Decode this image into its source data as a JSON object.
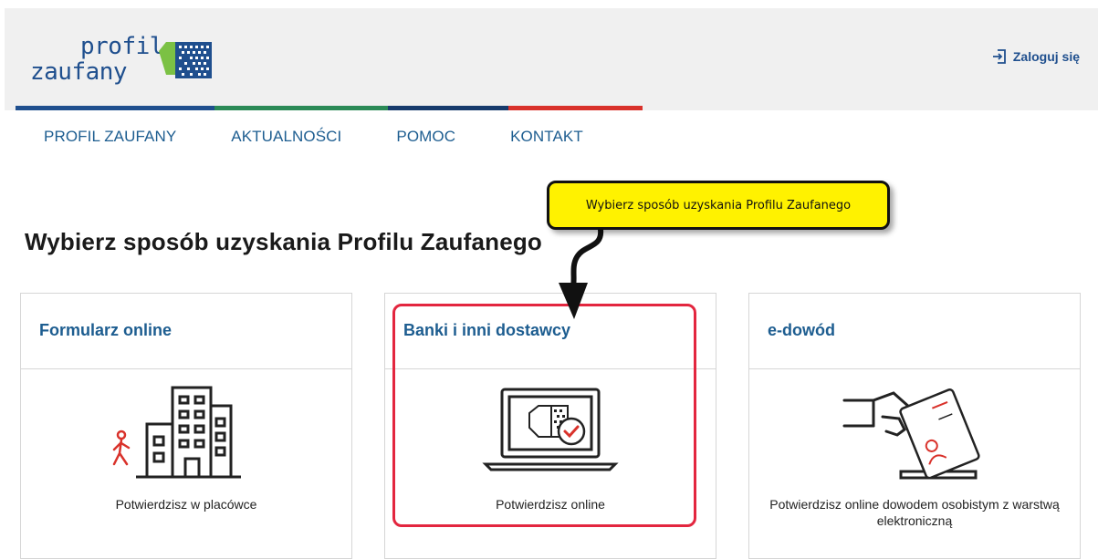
{
  "header": {
    "logo_line1": "profil",
    "logo_line2": "zaufany",
    "login_label": "Zaloguj się",
    "login_icon": "login-icon",
    "stripe_colors": [
      "#1f4f8e",
      "#2b8a57",
      "#173b6c",
      "#d9322b"
    ]
  },
  "nav": {
    "items": [
      "PROFIL ZAUFANY",
      "AKTUALNOŚCI",
      "POMOC",
      "KONTAKT"
    ]
  },
  "main": {
    "heading": "Wybierz sposób uzyskania Profilu Zaufanego",
    "cards": [
      {
        "title": "Formularz online",
        "icon": "office-building-icon",
        "description": "Potwierdzisz w placówce"
      },
      {
        "title": "Banki i inni dostawcy",
        "icon": "laptop-verification-icon",
        "description": "Potwierdzisz online"
      },
      {
        "title": "e-dowód",
        "icon": "id-card-icon",
        "description": "Potwierdzisz online dowodem osobistym z warstwą elektroniczną"
      }
    ]
  },
  "annotation": {
    "callout_text": "Wybierz sposób uzyskania Profilu Zaufanego",
    "callout_color": "#fff200",
    "highlight_color": "#e3263f"
  }
}
